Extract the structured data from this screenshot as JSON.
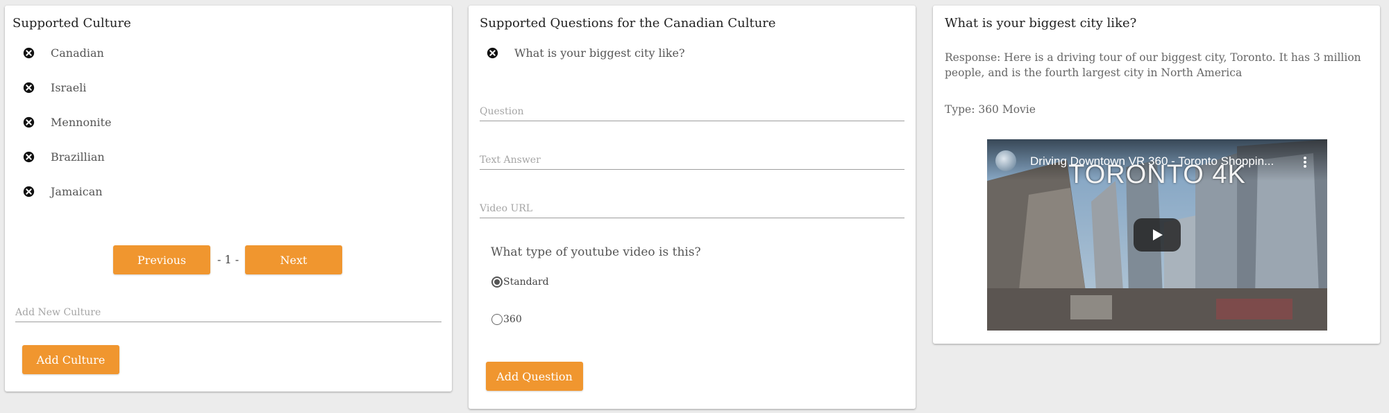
{
  "cultures_panel": {
    "title": "Supported Culture",
    "items": [
      {
        "label": "Canadian"
      },
      {
        "label": "Israeli"
      },
      {
        "label": "Mennonite"
      },
      {
        "label": "Brazillian"
      },
      {
        "label": "Jamaican"
      }
    ],
    "pagination": {
      "previous_label": "Previous",
      "page_indicator": "- 1 -",
      "next_label": "Next"
    },
    "new_culture_placeholder": "Add New Culture",
    "add_button_label": "Add Culture"
  },
  "questions_panel": {
    "title": "Supported Questions for the Canadian Culture",
    "items": [
      {
        "label": "What is your biggest city like?"
      }
    ],
    "question_placeholder": "Question",
    "text_answer_placeholder": "Text Answer",
    "video_url_placeholder": "Video URL",
    "video_type_prompt": "What type of youtube video is this?",
    "video_type_options": [
      {
        "label": "Standard",
        "selected": true
      },
      {
        "label": "360",
        "selected": false
      }
    ],
    "add_button_label": "Add Question"
  },
  "detail_panel": {
    "title": "What is your biggest city like?",
    "response": "Response: Here is a driving tour of our biggest city, Toronto. It has 3 million people, and is the fourth largest city in North America",
    "type": "Type: 360 Movie",
    "video": {
      "title": "Driving Downtown VR 360 - Toronto Shoppin...",
      "overlay_text": "TORONTO 4K"
    }
  },
  "colors": {
    "accent": "#f0962f",
    "background": "#ececec",
    "card": "#ffffff"
  },
  "icons": {
    "remove_item": "close-circle-icon",
    "play": "play-icon",
    "menu": "more-vert-icon"
  }
}
